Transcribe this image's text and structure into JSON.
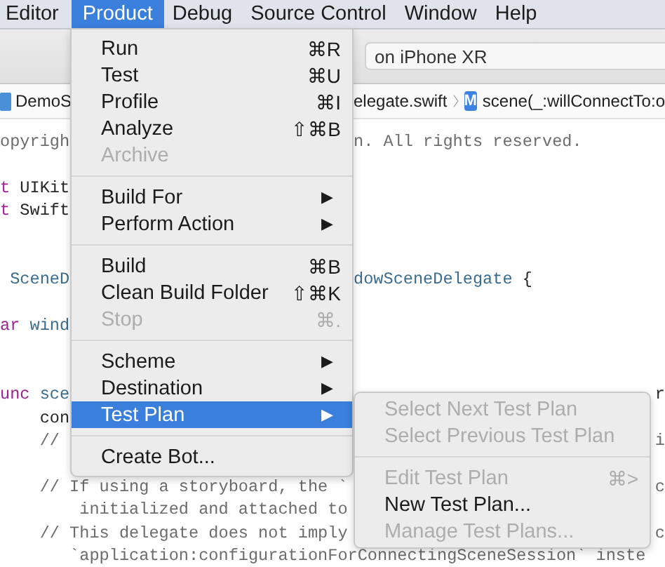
{
  "menu_bar": [
    {
      "label": "Editor",
      "selected": false
    },
    {
      "label": "Product",
      "selected": true
    },
    {
      "label": "Debug",
      "selected": false
    },
    {
      "label": "Source Control",
      "selected": false
    },
    {
      "label": "Window",
      "selected": false
    },
    {
      "label": "Help",
      "selected": false
    }
  ],
  "toolbar": {
    "scheme_field": "on iPhone XR"
  },
  "jump_bar": {
    "project": "DemoS",
    "file": "elegate.swift",
    "symbol_badge": "M",
    "symbol": "scene(_:willConnectTo:o"
  },
  "code_lines": [
    {
      "kind": "code",
      "left": [
        {
          "text": "opyrigh",
          "kind": "comment"
        }
      ],
      "right": [
        {
          "text": "n. All rights reserved.",
          "kind": "comment"
        }
      ]
    },
    {
      "kind": "blank"
    },
    {
      "kind": "code",
      "left": [
        {
          "text": "t",
          "kind": "keyword"
        },
        {
          "text": " UIKit",
          "kind": "plain"
        }
      ]
    },
    {
      "kind": "code",
      "left": [
        {
          "text": "t",
          "kind": "keyword"
        },
        {
          "text": " Swift",
          "kind": "plain"
        }
      ]
    },
    {
      "kind": "blank"
    },
    {
      "kind": "blank"
    },
    {
      "kind": "code",
      "left": [
        {
          "text": " SceneD",
          "kind": "type"
        }
      ],
      "right": [
        {
          "text": "dowSceneDelegate",
          "kind": "type"
        },
        {
          "text": " {",
          "kind": "plain"
        }
      ]
    },
    {
      "kind": "blank"
    },
    {
      "kind": "code",
      "left": [
        {
          "text": "ar",
          "kind": "keyword"
        },
        {
          "text": " wind",
          "kind": "type"
        }
      ]
    },
    {
      "kind": "blank"
    },
    {
      "kind": "blank"
    },
    {
      "kind": "code",
      "left": [
        {
          "text": "unc",
          "kind": "keyword"
        },
        {
          "text": " sce",
          "kind": "type"
        }
      ],
      "edge": [
        {
          "text": "r",
          "kind": "plain"
        }
      ]
    },
    {
      "kind": "code",
      "left": [
        {
          "text": "    con",
          "kind": "plain"
        }
      ]
    },
    {
      "kind": "code",
      "left": [
        {
          "text": "    //",
          "kind": "comment"
        }
      ],
      "edge": [
        {
          "text": "i",
          "kind": "comment"
        }
      ]
    },
    {
      "kind": "blank"
    },
    {
      "kind": "code",
      "left": [
        {
          "text": "    // If using a storyboard, the `",
          "kind": "comment"
        }
      ],
      "edge": [
        {
          "text": "c",
          "kind": "comment"
        }
      ]
    },
    {
      "kind": "code",
      "left": [
        {
          "text": "        initialized and attached to",
          "kind": "comment"
        }
      ]
    },
    {
      "kind": "code",
      "left": [
        {
          "text": "    // This delegate does not imply",
          "kind": "comment"
        }
      ],
      "edge": [
        {
          "text": "c",
          "kind": "comment"
        }
      ]
    },
    {
      "kind": "code",
      "left": [
        {
          "text": "       `application:configurationForConnectingSceneSession` inste",
          "kind": "comment"
        }
      ]
    }
  ],
  "product_menu": [
    {
      "kind": "item",
      "label": "Run",
      "shortcut": "⌘R",
      "disabled": false
    },
    {
      "kind": "item",
      "label": "Test",
      "shortcut": "⌘U",
      "disabled": false
    },
    {
      "kind": "item",
      "label": "Profile",
      "shortcut": "⌘I",
      "disabled": false
    },
    {
      "kind": "item",
      "label": "Analyze",
      "shortcut": "⇧⌘B",
      "disabled": false
    },
    {
      "kind": "item",
      "label": "Archive",
      "disabled": true
    },
    {
      "kind": "separator"
    },
    {
      "kind": "submenu",
      "label": "Build For",
      "arrow": "▶",
      "selected": false
    },
    {
      "kind": "submenu",
      "label": "Perform Action",
      "arrow": "▶",
      "selected": false
    },
    {
      "kind": "separator"
    },
    {
      "kind": "item",
      "label": "Build",
      "shortcut": "⌘B",
      "disabled": false
    },
    {
      "kind": "item",
      "label": "Clean Build Folder",
      "shortcut": "⇧⌘K",
      "disabled": false
    },
    {
      "kind": "item",
      "label": "Stop",
      "shortcut": "⌘.",
      "disabled": true
    },
    {
      "kind": "separator"
    },
    {
      "kind": "submenu",
      "label": "Scheme",
      "arrow": "▶",
      "selected": false
    },
    {
      "kind": "submenu",
      "label": "Destination",
      "arrow": "▶",
      "selected": false
    },
    {
      "kind": "submenu",
      "label": "Test Plan",
      "arrow": "▶",
      "selected": true
    },
    {
      "kind": "separator"
    },
    {
      "kind": "item",
      "label": "Create Bot...",
      "disabled": false
    }
  ],
  "test_plan_submenu": [
    {
      "kind": "item",
      "label": "Select Next Test Plan",
      "disabled": true
    },
    {
      "kind": "item",
      "label": "Select Previous Test Plan",
      "disabled": true
    },
    {
      "kind": "separator"
    },
    {
      "kind": "item",
      "label": "Edit Test Plan",
      "shortcut": "⌘>",
      "disabled": true
    },
    {
      "kind": "item",
      "label": "New Test Plan...",
      "disabled": false
    },
    {
      "kind": "item",
      "label": "Manage Test Plans...",
      "disabled": true
    }
  ]
}
